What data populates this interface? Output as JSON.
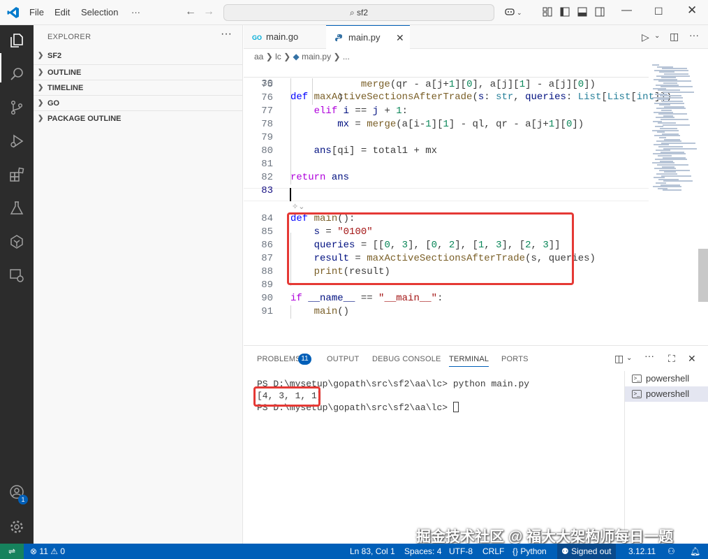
{
  "menu": {
    "file": "File",
    "edit": "Edit",
    "selection": "Selection",
    "more": "···"
  },
  "search": {
    "text": "sf2"
  },
  "sidebar": {
    "title": "EXPLORER",
    "more": "···",
    "sections": [
      "SF2",
      "OUTLINE",
      "TIMELINE",
      "GO",
      "PACKAGE OUTLINE"
    ]
  },
  "activity": {
    "account_badge": "1"
  },
  "tabs": [
    {
      "label": "main.go"
    },
    {
      "label": "main.py"
    }
  ],
  "breadcrumb": [
    "aa",
    "lc",
    "main.py",
    "..."
  ],
  "editor": {
    "sticky": {
      "num": "30",
      "tokens": [
        [
          "kw",
          "def "
        ],
        [
          "fn",
          "maxActiveSectionsAfterTrade"
        ],
        [
          "",
          "("
        ],
        [
          "var",
          "s"
        ],
        [
          "",
          ": "
        ],
        [
          "ty",
          "str"
        ],
        [
          "",
          ", "
        ],
        [
          "var",
          "queries"
        ],
        [
          "",
          ": "
        ],
        [
          "ty",
          "List"
        ],
        [
          "",
          "["
        ],
        [
          "ty",
          "List"
        ],
        [
          "",
          "["
        ],
        [
          "ty",
          "int"
        ],
        [
          "",
          "]])"
        ]
      ]
    },
    "lines": [
      {
        "num": "75",
        "tokens": [
          [
            "",
            "            "
          ],
          [
            "fn",
            "merge"
          ],
          [
            "",
            "(qr - a[j+"
          ],
          [
            "num",
            "1"
          ],
          [
            "",
            "]["
          ],
          [
            "num",
            "0"
          ],
          [
            "",
            "], a[j]["
          ],
          [
            "num",
            "1"
          ],
          [
            "",
            "] - a[j]["
          ],
          [
            "num",
            "0"
          ],
          [
            "",
            "])"
          ]
        ]
      },
      {
        "num": "76",
        "tokens": [
          [
            "",
            "        )"
          ]
        ]
      },
      {
        "num": "77",
        "tokens": [
          [
            "",
            "    "
          ],
          [
            "kw2",
            "elif "
          ],
          [
            "var",
            "i"
          ],
          [
            "",
            " == "
          ],
          [
            "var",
            "j"
          ],
          [
            "",
            " + "
          ],
          [
            "num",
            "1"
          ],
          [
            "",
            ":"
          ]
        ]
      },
      {
        "num": "78",
        "tokens": [
          [
            "",
            "        "
          ],
          [
            "var",
            "mx"
          ],
          [
            "",
            " = "
          ],
          [
            "fn",
            "merge"
          ],
          [
            "",
            "(a[i-"
          ],
          [
            "num",
            "1"
          ],
          [
            "",
            "]["
          ],
          [
            "num",
            "1"
          ],
          [
            "",
            "] - ql, qr - a[j+"
          ],
          [
            "num",
            "1"
          ],
          [
            "",
            "]["
          ],
          [
            "num",
            "0"
          ],
          [
            "",
            "])"
          ]
        ]
      },
      {
        "num": "79",
        "tokens": []
      },
      {
        "num": "80",
        "tokens": [
          [
            "",
            "    "
          ],
          [
            "var",
            "ans"
          ],
          [
            "",
            "[qi] = total1 + mx"
          ]
        ]
      },
      {
        "num": "81",
        "tokens": []
      },
      {
        "num": "82",
        "tokens": [
          [
            "kw2",
            "return "
          ],
          [
            "var",
            "ans"
          ]
        ]
      },
      {
        "num": "83",
        "tokens": []
      },
      {
        "num": "84",
        "tokens": [
          [
            "kw",
            "def "
          ],
          [
            "fn",
            "main"
          ],
          [
            "",
            "():"
          ]
        ]
      },
      {
        "num": "85",
        "tokens": [
          [
            "",
            "    "
          ],
          [
            "var",
            "s"
          ],
          [
            "",
            " = "
          ],
          [
            "str",
            "\"0100\""
          ]
        ]
      },
      {
        "num": "86",
        "tokens": [
          [
            "",
            "    "
          ],
          [
            "var",
            "queries"
          ],
          [
            "",
            " = [["
          ],
          [
            "num",
            "0"
          ],
          [
            "",
            ", "
          ],
          [
            "num",
            "3"
          ],
          [
            "",
            "], ["
          ],
          [
            "num",
            "0"
          ],
          [
            "",
            ", "
          ],
          [
            "num",
            "2"
          ],
          [
            "",
            "], ["
          ],
          [
            "num",
            "1"
          ],
          [
            "",
            ", "
          ],
          [
            "num",
            "3"
          ],
          [
            "",
            "], ["
          ],
          [
            "num",
            "2"
          ],
          [
            "",
            ", "
          ],
          [
            "num",
            "3"
          ],
          [
            "",
            "]]"
          ]
        ]
      },
      {
        "num": "87",
        "tokens": [
          [
            "",
            "    "
          ],
          [
            "var",
            "result"
          ],
          [
            "",
            " = "
          ],
          [
            "fn",
            "maxActiveSectionsAfterTrade"
          ],
          [
            "",
            "(s, queries)"
          ]
        ]
      },
      {
        "num": "88",
        "tokens": [
          [
            "",
            "    "
          ],
          [
            "fn",
            "print"
          ],
          [
            "",
            "(result)"
          ]
        ]
      },
      {
        "num": "89",
        "tokens": []
      },
      {
        "num": "90",
        "tokens": [
          [
            "kw2",
            "if "
          ],
          [
            "var",
            "__name__"
          ],
          [
            "",
            " == "
          ],
          [
            "str",
            "\"__main__\""
          ],
          [
            "",
            ":"
          ]
        ]
      },
      {
        "num": "91",
        "tokens": [
          [
            "",
            "    "
          ],
          [
            "fn",
            "main"
          ],
          [
            "",
            "()"
          ]
        ]
      }
    ]
  },
  "panel": {
    "tabs": [
      "PROBLEMS",
      "OUTPUT",
      "DEBUG CONSOLE",
      "TERMINAL",
      "PORTS"
    ],
    "problems_count": "11",
    "terminal": [
      "PS D:\\mysetup\\gopath\\src\\sf2\\aa\\lc> python main.py",
      "[4, 3, 1, 1]",
      "PS D:\\mysetup\\gopath\\src\\sf2\\aa\\lc> "
    ],
    "terminals": [
      "powershell",
      "powershell"
    ]
  },
  "status": {
    "errors": "11",
    "warnings": "0",
    "position": "Ln 83, Col 1",
    "spaces": "Spaces: 4",
    "encoding": "UTF-8",
    "eol": "CRLF",
    "language": "Python",
    "account": "Signed out",
    "version": "3.12.11"
  },
  "watermark": "掘金技术社区 @ 福大大架构师每日一题"
}
